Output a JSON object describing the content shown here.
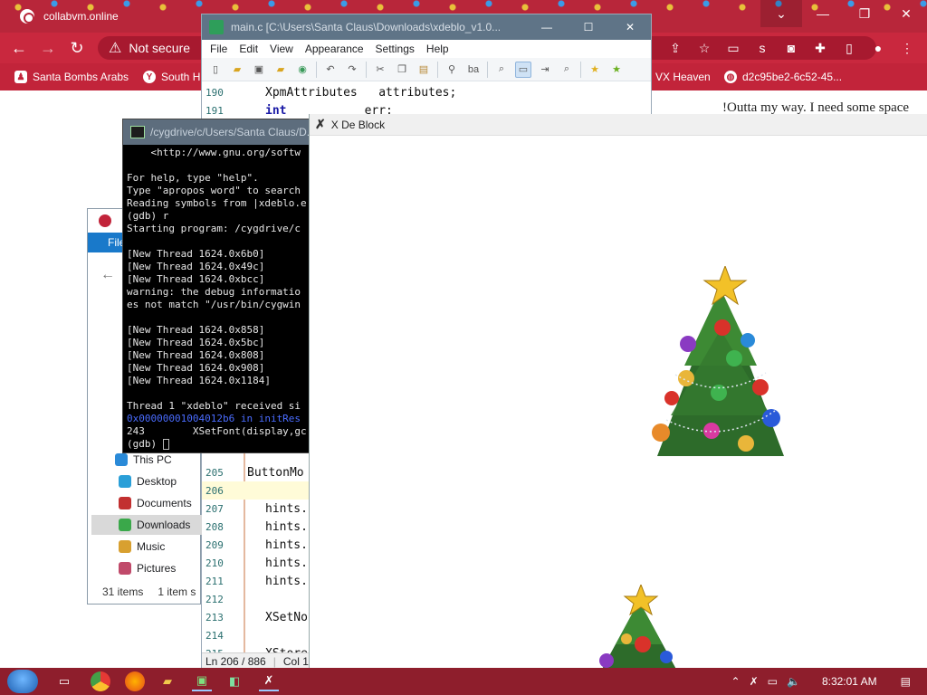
{
  "browser": {
    "tab_title": "collabvm.online",
    "window_controls": [
      "⌄",
      "—",
      "❐",
      "✕"
    ],
    "url_warning": "Not secure",
    "bookmarks": [
      {
        "label": "Santa Bombs Arabs",
        "icon": "person-icon"
      },
      {
        "label": "South H",
        "icon": "yandex-icon"
      },
      {
        "label": "VX Heaven",
        "icon": "blank-icon"
      },
      {
        "label": "d2c95be2-6c52-45...",
        "icon": "globe-icon"
      }
    ],
    "page_text": "!Outta my way. I need some space"
  },
  "editor": {
    "title": "main.c [C:\\Users\\Santa Claus\\Downloads\\xdeblo_v1.0...",
    "menu": [
      "File",
      "Edit",
      "View",
      "Appearance",
      "Settings",
      "Help"
    ],
    "lines_top": [
      {
        "num": "190",
        "pre": "XpmAttributes",
        "post": "   attributes;",
        "kw": ""
      },
      {
        "num": "191",
        "pre": "",
        "post": "           err;",
        "kw": "int"
      }
    ],
    "lines_bottom": [
      {
        "num": "205",
        "code": "ButtonMo"
      },
      {
        "num": "206",
        "code": ""
      },
      {
        "num": "207",
        "code": "hints."
      },
      {
        "num": "208",
        "code": "hints."
      },
      {
        "num": "209",
        "code": "hints."
      },
      {
        "num": "210",
        "code": "hints."
      },
      {
        "num": "211",
        "code": "hints."
      },
      {
        "num": "212",
        "code": ""
      },
      {
        "num": "213",
        "code": "XSetNo"
      },
      {
        "num": "214",
        "code": ""
      },
      {
        "num": "215",
        "code": "XStore"
      }
    ],
    "status_ln": "Ln  206 / 886",
    "status_col": "Col  1 /"
  },
  "explorer": {
    "ribbon_label": "File",
    "nav": [
      {
        "label": "This PC",
        "color": "#2a8ad8"
      },
      {
        "label": "Desktop",
        "color": "#2a9fd8"
      },
      {
        "label": "Documents",
        "color": "#c23030"
      },
      {
        "label": "Downloads",
        "color": "#3aa84a"
      },
      {
        "label": "Music",
        "color": "#d8a030"
      },
      {
        "label": "Pictures",
        "color": "#c04a6a"
      }
    ],
    "status_items": "31 items",
    "status_selected": "1 item s"
  },
  "terminal": {
    "title": "/cygdrive/c/Users/Santa Claus/D...",
    "lines": [
      "    <http://www.gnu.org/softw",
      "",
      "For help, type \"help\".",
      "Type \"apropos word\" to search",
      "Reading symbols from |xdeblo.e",
      "(gdb) r",
      "Starting program: /cygdrive/c",
      "",
      "[New Thread 1624.0x6b0]",
      "[New Thread 1624.0x49c]",
      "[New Thread 1624.0xbcc]",
      "warning: the debug informatio",
      "es not match \"/usr/bin/cygwin",
      "",
      "[New Thread 1624.0x858]",
      "[New Thread 1624.0x5bc]",
      "[New Thread 1624.0x808]",
      "[New Thread 1624.0x908]",
      "[New Thread 1624.0x1184]",
      "",
      "Thread 1 \"xdeblo\" received si",
      "0x00000001004012b6 in initRes",
      "243        XSetFont(display,gc",
      "(gdb) "
    ]
  },
  "xdeblo": {
    "title": "X De Block"
  },
  "taskbar": {
    "clock": "8:32:01 AM"
  }
}
